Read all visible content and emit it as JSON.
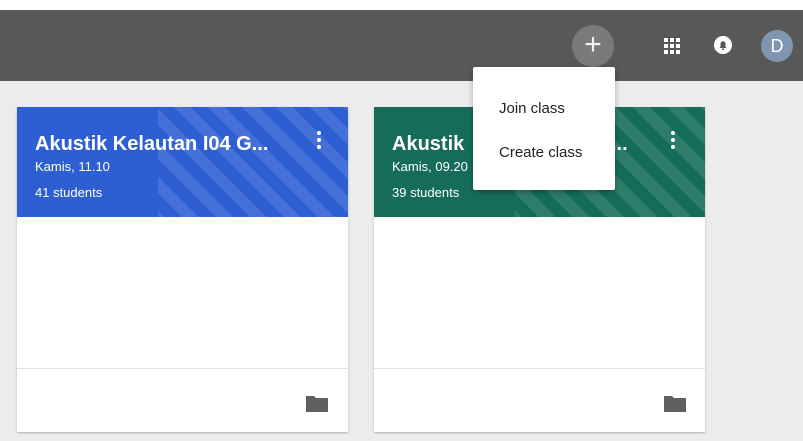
{
  "header": {
    "add_icon": "plus-icon",
    "add_symbol": "+",
    "apps_icon": "apps-grid-icon",
    "notifications_icon": "bell-icon",
    "avatar_initial": "D"
  },
  "classes": [
    {
      "title": "Akustik Kelautan I04 G...",
      "schedule": "Kamis, 11.10",
      "students": "41 students",
      "color": "#2d5fd2"
    },
    {
      "title": "Akustik",
      "title_suffix": "...",
      "schedule": "Kamis, 09.20",
      "students": "39 students",
      "color": "#156d59"
    }
  ],
  "add_menu": {
    "items": [
      "Join class",
      "Create class"
    ]
  }
}
